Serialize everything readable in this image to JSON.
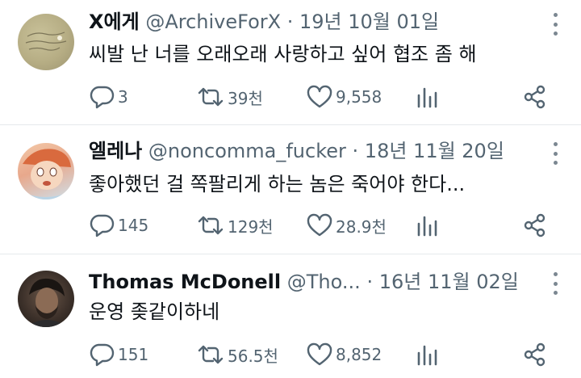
{
  "tweets": [
    {
      "name": "X에게",
      "handle": "@ArchiveForX",
      "separator": "·",
      "date": "19년 10월 01일",
      "text": "씨발 난 너를 오래오래 사랑하고 싶어 협조 좀 해",
      "replies": "3",
      "retweets": "39천",
      "likes": "9,558"
    },
    {
      "name": "엘레나",
      "handle": "@noncomma_fucker",
      "separator": "·",
      "date": "18년 11월 20일",
      "text": "좋아했던 걸 쪽팔리게 하는 놈은 죽어야 한다...",
      "replies": "145",
      "retweets": "129천",
      "likes": "28.9천"
    },
    {
      "name": "Thomas McDonell",
      "handle": "@Tho...",
      "separator": "·",
      "date": "16년 11월 02일",
      "text": "운영 좆같이하네",
      "replies": "151",
      "retweets": "56.5천",
      "likes": "8,852"
    }
  ],
  "colors": {
    "text_primary": "#0f1419",
    "text_secondary": "#536471",
    "divider": "#e6e9ec"
  },
  "icons": [
    "reply-icon",
    "retweet-icon",
    "like-icon",
    "views-icon",
    "share-icon",
    "more-icon"
  ]
}
